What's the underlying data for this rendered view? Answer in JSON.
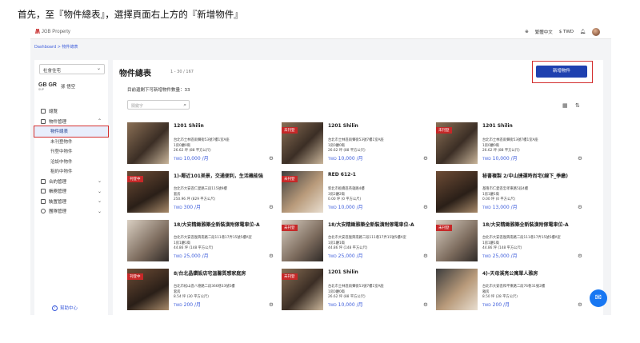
{
  "instruction": "首先，至『物件總表』，選擇頁面右上方的『新增物件』",
  "header": {
    "logo_mark": "///\\",
    "brand": "JGB Property",
    "lang": "繁體中文",
    "currency": "$ TWD"
  },
  "breadcrumb": "Dashboard > 物件總表",
  "sidebar": {
    "selector": "社會住宅",
    "user_logo": "GB GR",
    "user_sub": "SUP",
    "user_name": "孫 悟空",
    "items": [
      {
        "label": "總覽"
      },
      {
        "label": "物件管理"
      },
      {
        "label": "物件總表"
      },
      {
        "label": "未刊登物件"
      },
      {
        "label": "刊登中物件"
      },
      {
        "label": "洽談中物件"
      },
      {
        "label": "租約中物件"
      },
      {
        "label": "合約管理"
      },
      {
        "label": "帳務管理"
      },
      {
        "label": "裝置管理"
      },
      {
        "label": "團隊管理"
      }
    ],
    "help": "幫助中心"
  },
  "main": {
    "title": "物件總表",
    "count": "1 - 30 / 167",
    "quota": "目前還剩下可新增物件數量：33",
    "search_placeholder": "關鍵字",
    "more": "•••",
    "add_button": "新增物件"
  },
  "cards": [
    {
      "title": "1201 Shilin",
      "badge": "",
      "addr": "台北市士林區雨聲街53號7樓1室A座",
      "type": "1房0廳0衛",
      "area": "26.62 坪 (88 平方公尺)",
      "cur": "TWD",
      "price": "10,000 /月"
    },
    {
      "title": "1201 Shilin",
      "badge": "未刊登",
      "addr": "台北市士林區雨聲街53號7樓1室A座",
      "type": "1房0廳0衛",
      "area": "26.62 坪 (88 平方公尺)",
      "cur": "TWD",
      "price": "10,000 /月"
    },
    {
      "title": "1201 Shilin",
      "badge": "未刊登",
      "addr": "台北市士林區雨聲街53號7樓1室A座",
      "type": "1房0廳0衛",
      "area": "26.62 坪 (88 平方公尺)",
      "cur": "TWD",
      "price": "10,000 /月"
    },
    {
      "title": "1)-鄰近101美景，交通便利，生活機能強",
      "badge": "刊登中",
      "addr": "台北市大安區仁愛路三段115號9樓",
      "type": "套房",
      "area": "250.96 坪 (829 平方公尺)",
      "cur": "TWD",
      "price": "300 /月"
    },
    {
      "title": "RED 612-1",
      "badge": "未刊登",
      "addr": "新北市板橋區英雄路4樓",
      "type": "3房2廳2衛",
      "area": "0.00 坪 (0 平方公尺)",
      "cur": "TWD",
      "price": "10,000 /月"
    },
    {
      "title": "秘書複製 2/中山捷運時尚宅(線下_季繳)",
      "badge": "",
      "addr": "基隆市仁愛區忠孝東路5段4樓",
      "type": "1房1廳1衛",
      "area": "0.00 坪 (0 平方公尺)",
      "cur": "TWD",
      "price": "13,000 /月"
    },
    {
      "title": "18/大安精緻雅築全新裝潢附傢電車位-A",
      "badge": "",
      "addr": "台北市大安區復興南路二段111巷17弄15號5樓A室",
      "type": "1房1廳1衛",
      "area": "44.86 坪 (148 平方公尺)",
      "cur": "TWD",
      "price": "25,000 /月"
    },
    {
      "title": "18/大安精緻雅築全新裝潢附傢電車位-A",
      "badge": "未刊登",
      "addr": "台北市大安區復興南路二段111巷17弄15號5樓A室",
      "type": "1房1廳1衛",
      "area": "44.86 坪 (148 平方公尺)",
      "cur": "TWD",
      "price": "25,000 /月"
    },
    {
      "title": "18/大安精緻雅築全新裝潢附傢電車位-A",
      "badge": "未刊登",
      "addr": "台北市大安區復興南路二段111巷17弄15號5樓A室",
      "type": "1房1廳1衛",
      "area": "44.86 坪 (148 平方公尺)",
      "cur": "TWD",
      "price": "25,000 /月"
    },
    {
      "title": "8/台北晶鑽設店宅溫馨質感家庭房",
      "badge": "刊登中",
      "addr": "台北市松山區八德路二段366巷33號5樓",
      "type": "套房",
      "area": "8.54 坪 (30 平方公尺)",
      "cur": "TWD",
      "price": "200 /月"
    },
    {
      "title": "1201 Shilin",
      "badge": "未刊登",
      "addr": "台北市士林區雨聲街53號7樓1室A座",
      "type": "1房0廳0衛",
      "area": "26.62 坪 (88 平方公尺)",
      "cur": "TWD",
      "price": "10,000 /月"
    },
    {
      "title": "4)-天母溪亮公寓單人雅房",
      "badge": "",
      "addr": "台北市大安區和平東路二段76巷31號2樓",
      "type": "雅房",
      "area": "8.50 坪 (28 平方公尺)",
      "cur": "TWD",
      "price": "200 /月"
    }
  ]
}
